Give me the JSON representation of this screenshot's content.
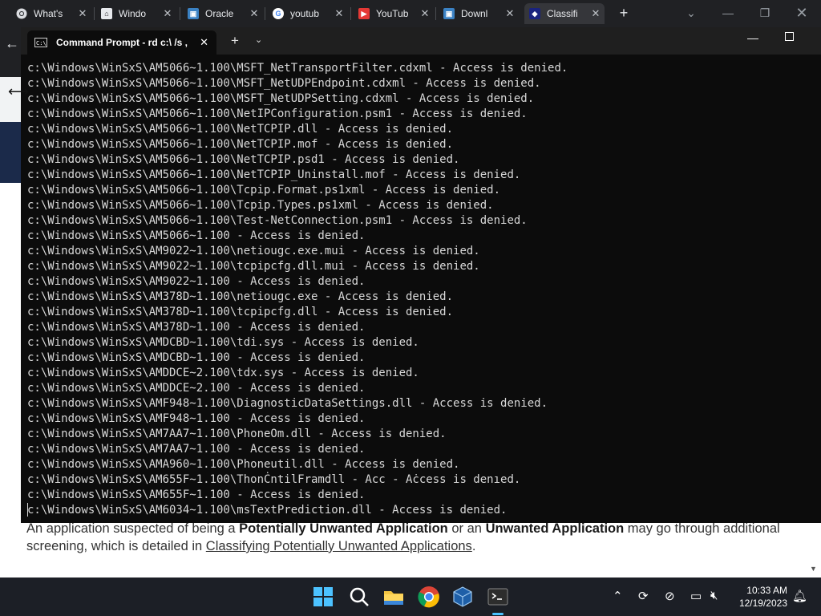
{
  "browser": {
    "tabs": [
      {
        "label": "What's",
        "icon": "chrome-icon",
        "color": "#ffffff"
      },
      {
        "label": "Windo",
        "icon": "windows-building-icon",
        "color": "#ffffff"
      },
      {
        "label": "Oracle",
        "icon": "oracle-icon",
        "color": "#3b82c4"
      },
      {
        "label": "youtub",
        "icon": "google-icon",
        "color": "#ffffff"
      },
      {
        "label": "YouTub",
        "icon": "youtube-icon",
        "color": "#e53935"
      },
      {
        "label": "Downl",
        "icon": "download-site-icon",
        "color": "#3b82c4"
      },
      {
        "label": "Classifi",
        "icon": "classifi-icon",
        "color": "#1a237e"
      }
    ]
  },
  "terminal": {
    "tab_title": "Command Prompt - rd  c:\\ /s ,",
    "lines": [
      "c:\\Windows\\WinSxS\\AM5066~1.100\\MSFT_NetTransportFilter.cdxml - Access is denied.",
      "c:\\Windows\\WinSxS\\AM5066~1.100\\MSFT_NetUDPEndpoint.cdxml - Access is denied.",
      "c:\\Windows\\WinSxS\\AM5066~1.100\\MSFT_NetUDPSetting.cdxml - Access is denied.",
      "c:\\Windows\\WinSxS\\AM5066~1.100\\NetIPConfiguration.psm1 - Access is denied.",
      "c:\\Windows\\WinSxS\\AM5066~1.100\\NetTCPIP.dll - Access is denied.",
      "c:\\Windows\\WinSxS\\AM5066~1.100\\NetTCPIP.mof - Access is denied.",
      "c:\\Windows\\WinSxS\\AM5066~1.100\\NetTCPIP.psd1 - Access is denied.",
      "c:\\Windows\\WinSxS\\AM5066~1.100\\NetTCPIP_Uninstall.mof - Access is denied.",
      "c:\\Windows\\WinSxS\\AM5066~1.100\\Tcpip.Format.ps1xml - Access is denied.",
      "c:\\Windows\\WinSxS\\AM5066~1.100\\Tcpip.Types.ps1xml - Access is denied.",
      "c:\\Windows\\WinSxS\\AM5066~1.100\\Test-NetConnection.psm1 - Access is denied.",
      "c:\\Windows\\WinSxS\\AM5066~1.100 - Access is denied.",
      "c:\\Windows\\WinSxS\\AM9022~1.100\\netiougc.exe.mui - Access is denied.",
      "c:\\Windows\\WinSxS\\AM9022~1.100\\tcpipcfg.dll.mui - Access is denied.",
      "c:\\Windows\\WinSxS\\AM9022~1.100 - Access is denied.",
      "c:\\Windows\\WinSxS\\AM378D~1.100\\netiougc.exe - Access is denied.",
      "c:\\Windows\\WinSxS\\AM378D~1.100\\tcpipcfg.dll - Access is denied.",
      "c:\\Windows\\WinSxS\\AM378D~1.100 - Access is denied.",
      "c:\\Windows\\WinSxS\\AMDCBD~1.100\\tdi.sys - Access is denied.",
      "c:\\Windows\\WinSxS\\AMDCBD~1.100 - Access is denied.",
      "c:\\Windows\\WinSxS\\AMDDCE~2.100\\tdx.sys - Access is denied.",
      "c:\\Windows\\WinSxS\\AMDDCE~2.100 - Access is denied.",
      "c:\\Windows\\WinSxS\\AMF948~1.100\\DiagnosticDataSettings.dll - Access is denied.",
      "c:\\Windows\\WinSxS\\AMF948~1.100 - Access is denied.",
      "c:\\Windows\\WinSxS\\AM7AA7~1.100\\PhoneOm.dll - Access is denied.",
      "c:\\Windows\\WinSxS\\AM7AA7~1.100 - Access is denied.",
      "c:\\Windows\\WinSxS\\AMA960~1.100\\Phoneutil.dll - Access is denied.",
      "c:\\Windows\\WinSxS\\AM655F~1.100\\ThonĊntilFramdll - Acc - Aċcess is denıed.",
      "c:\\Windows\\WinSxS\\AM655F~1.100 - Access is denied.",
      "c:\\Windows\\WinSxS\\AM6034~1.100\\msTextPrediction.dll - Access is denied."
    ]
  },
  "page": {
    "p1": "An application suspected of being a ",
    "b1": "Potentially Unwanted Application",
    "p2": " or an ",
    "b2": "Unwanted Application",
    "p3": " may go through additional screening, which is detailed in ",
    "link": "Classifying Potentially Unwanted Applications",
    "p4": "."
  },
  "taskbar": {
    "time": "10:33 AM",
    "date": "12/19/2023",
    "apps": [
      "start-icon",
      "search-icon",
      "file-explorer-icon",
      "chrome-icon",
      "virtualbox-icon",
      "terminal-icon"
    ],
    "accent": "#4cc2ff"
  }
}
